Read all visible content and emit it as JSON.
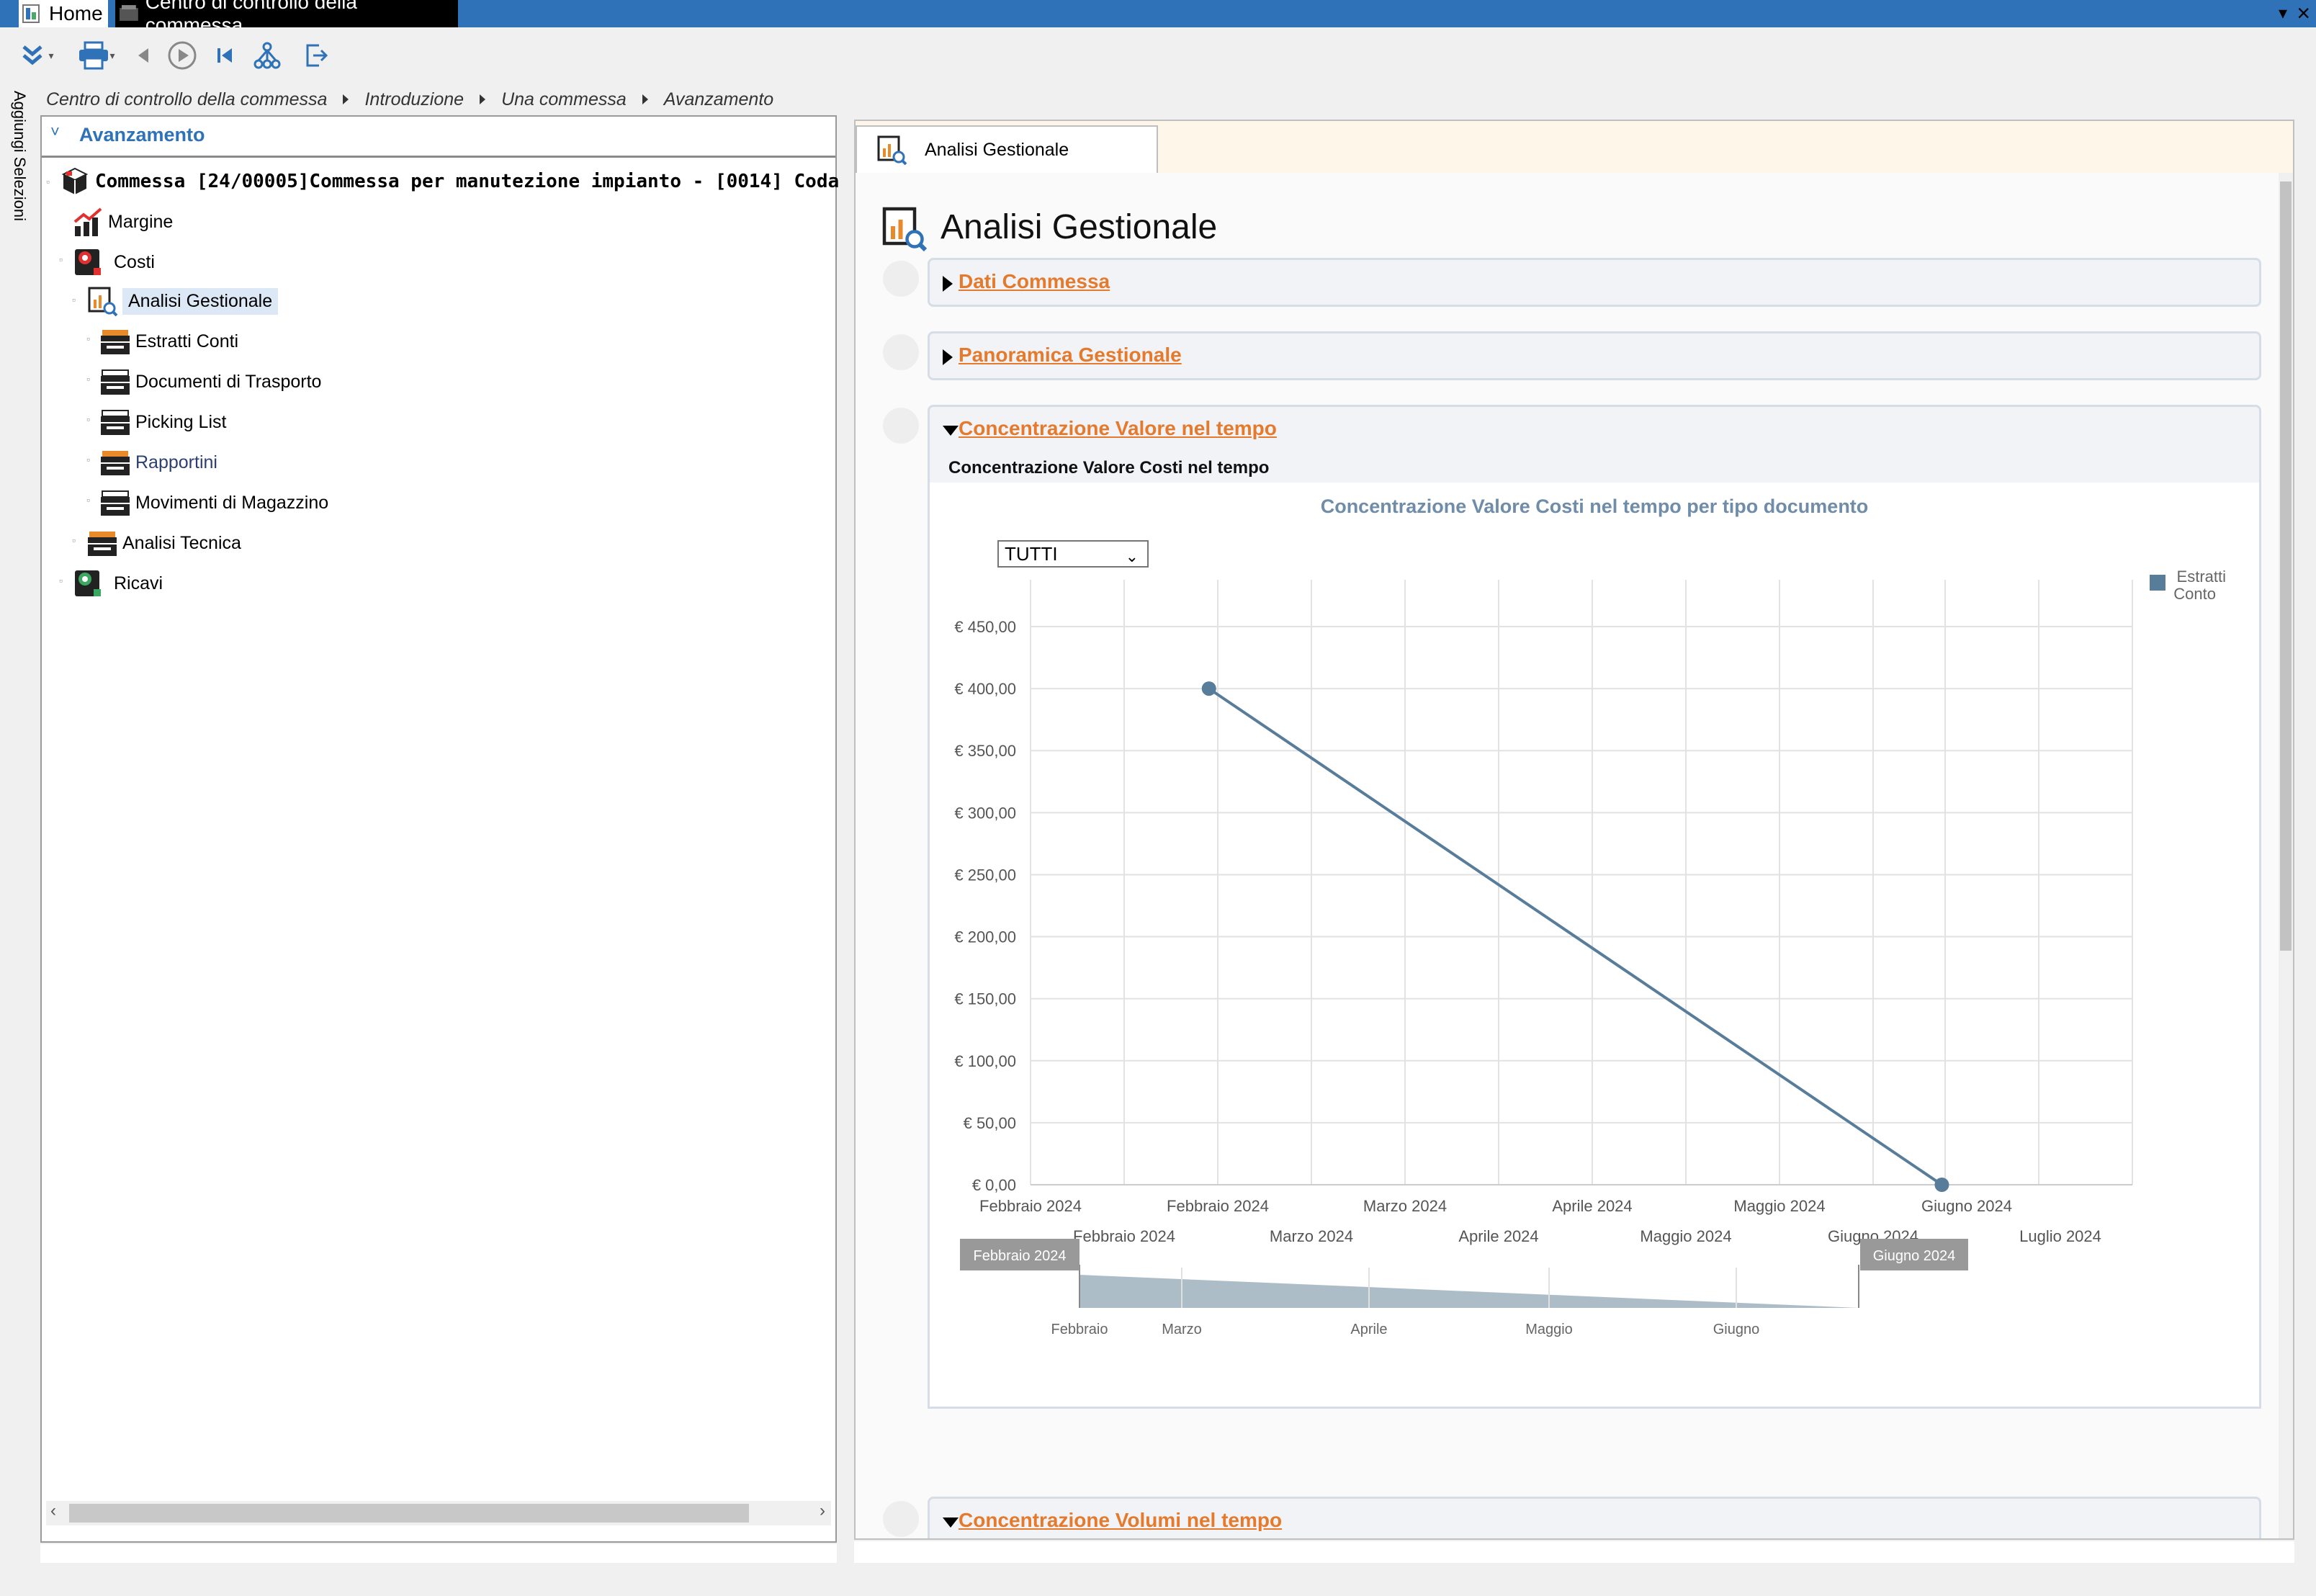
{
  "tabs": {
    "home": "Home",
    "control_center": "Centro di controllo della commessa"
  },
  "side_tab": "Aggiungi Selezioni",
  "breadcrumb": [
    "Centro di controllo della commessa",
    "Introduzione",
    "Una commessa",
    "Avanzamento"
  ],
  "left": {
    "header": "Avanzamento",
    "root": "Commessa [24/00005]Commessa per manutezione impianto - [0014] Coda",
    "items": {
      "margine": "Margine",
      "costi": "Costi",
      "analisi_gestionale": "Analisi Gestionale",
      "estratti_conti": "Estratti Conti",
      "documenti_trasporto": "Documenti di Trasporto",
      "picking_list": "Picking List",
      "rapportini": "Rapportini",
      "movimenti_magazzino": "Movimenti di Magazzino",
      "analisi_tecnica": "Analisi Tecnica",
      "ricavi": "Ricavi"
    }
  },
  "right": {
    "tab": "Analisi Gestionale",
    "page_title": "Analisi Gestionale",
    "sections": {
      "dati": "Dati Commessa",
      "panoramica": "Panoramica Gestionale",
      "concentrazione_valore": "Concentrazione Valore nel tempo",
      "concentrazione_volumi": "Concentrazione Volumi nel tempo"
    },
    "subsection": "Concentrazione Valore Costi nel tempo",
    "select_value": "TUTTI"
  },
  "chart_data": {
    "type": "line",
    "title": "Concentrazione Valore Costi nel tempo per tipo documento",
    "y_ticks": [
      "€ 0,00",
      "€ 50,00",
      "€ 100,00",
      "€ 150,00",
      "€ 200,00",
      "€ 250,00",
      "€ 300,00",
      "€ 350,00",
      "€ 400,00",
      "€ 450,00"
    ],
    "ylim": [
      0,
      450
    ],
    "x_ticks_row1": [
      "Febbraio 2024",
      "Febbraio 2024",
      "Marzo 2024",
      "Aprile 2024",
      "Maggio 2024",
      "Giugno 2024"
    ],
    "x_ticks_row2": [
      "Febbraio 2024",
      "Marzo 2024",
      "Aprile 2024",
      "Maggio 2024",
      "Giugno 2024",
      "Luglio 2024"
    ],
    "series": [
      {
        "name": "Estratti Conto",
        "color": "#587d9b",
        "points": [
          {
            "x": "2024-02-15",
            "y": 400
          },
          {
            "x": "2024-06-15",
            "y": 0
          }
        ]
      }
    ],
    "legend": "top-right",
    "grid": true,
    "navigator": {
      "start_label": "Febbraio 2024",
      "end_label": "Giugno 2024",
      "ticks": [
        "Febbraio",
        "Marzo",
        "Aprile",
        "Maggio",
        "Giugno"
      ]
    }
  }
}
